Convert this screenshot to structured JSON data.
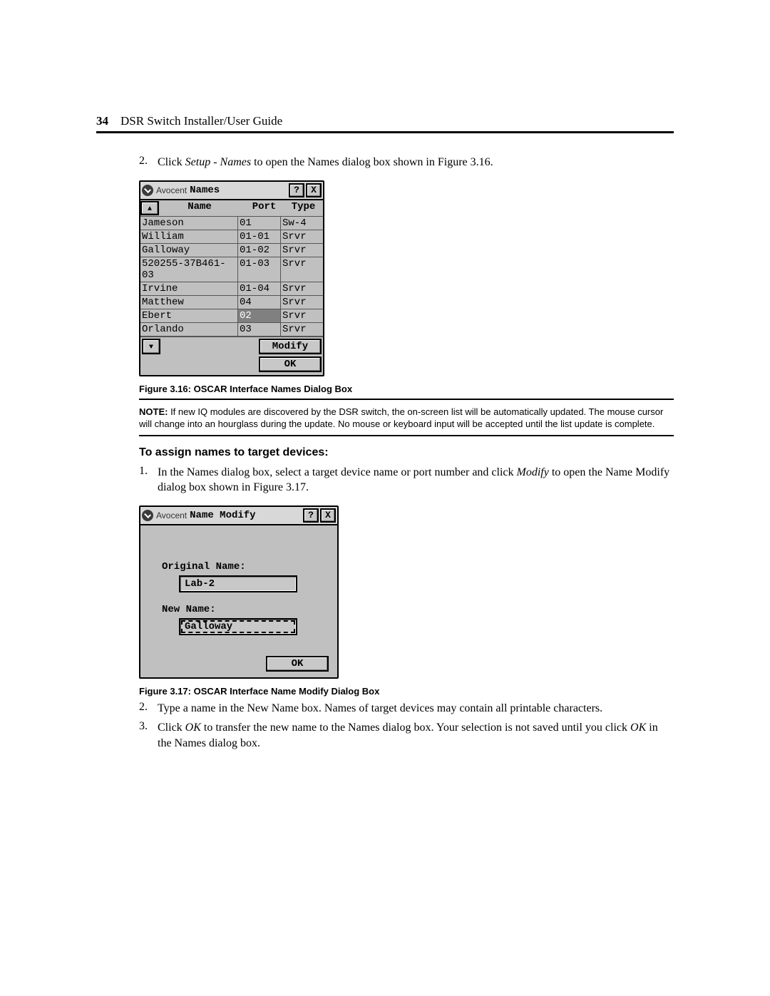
{
  "header": {
    "page_number": "34",
    "doc_title": "DSR Switch Installer/User Guide"
  },
  "intro_step": {
    "num": "2.",
    "pre": "Click ",
    "em": "Setup - Names",
    "post": " to open the Names dialog box shown in Figure 3.16."
  },
  "dialog_names": {
    "brand": "Avocent",
    "title": "Names",
    "help": "?",
    "close": "X",
    "columns": {
      "name": "Name",
      "port": "Port",
      "type": "Type"
    },
    "rows": [
      {
        "name": "Jameson",
        "port": "01",
        "type": "Sw-4",
        "selected": false
      },
      {
        "name": "William",
        "port": "01-01",
        "type": "Srvr",
        "selected": false
      },
      {
        "name": "Galloway",
        "port": "01-02",
        "type": "Srvr",
        "selected": false
      },
      {
        "name": "520255-37B461-03",
        "port": "01-03",
        "type": "Srvr",
        "selected": false
      },
      {
        "name": "Irvine",
        "port": "01-04",
        "type": "Srvr",
        "selected": false
      },
      {
        "name": "Matthew",
        "port": "04",
        "type": "Srvr",
        "selected": false
      },
      {
        "name": "Ebert",
        "port": "02",
        "type": "Srvr",
        "selected": true
      },
      {
        "name": "Orlando",
        "port": "03",
        "type": "Srvr",
        "selected": false
      }
    ],
    "btn_modify": "Modify",
    "btn_ok": "OK"
  },
  "caption316": "Figure 3.16: OSCAR Interface Names Dialog Box",
  "note": {
    "label": "NOTE:",
    "text": " If new IQ modules are discovered by the DSR switch, the on-screen list will be automatically updated. The mouse cursor will change into an hourglass during the update. No mouse or keyboard input will be accepted until the list update is complete."
  },
  "section_heading": "To assign names to target devices:",
  "step1": {
    "num": "1.",
    "pre": "In the Names dialog box, select a target device name or port number and click ",
    "em": "Modify",
    "post": " to open the Name Modify dialog box shown in Figure 3.17."
  },
  "dialog_modify": {
    "brand": "Avocent",
    "title": "Name Modify",
    "help": "?",
    "close": "X",
    "label_original": "Original Name:",
    "value_original": "Lab-2",
    "label_new": "New Name:",
    "value_new": "Galloway",
    "btn_ok": "OK"
  },
  "caption317": "Figure 3.17: OSCAR Interface Name Modify Dialog Box",
  "step2": {
    "num": "2.",
    "text": "Type a name in the New Name box. Names of target devices may contain all printable characters."
  },
  "step3": {
    "num": "3.",
    "pre": "Click ",
    "em1": "OK",
    "mid": " to transfer the new name to the Names dialog box. Your selection is not saved until you click ",
    "em2": "OK",
    "post": " in the Names dialog box."
  }
}
